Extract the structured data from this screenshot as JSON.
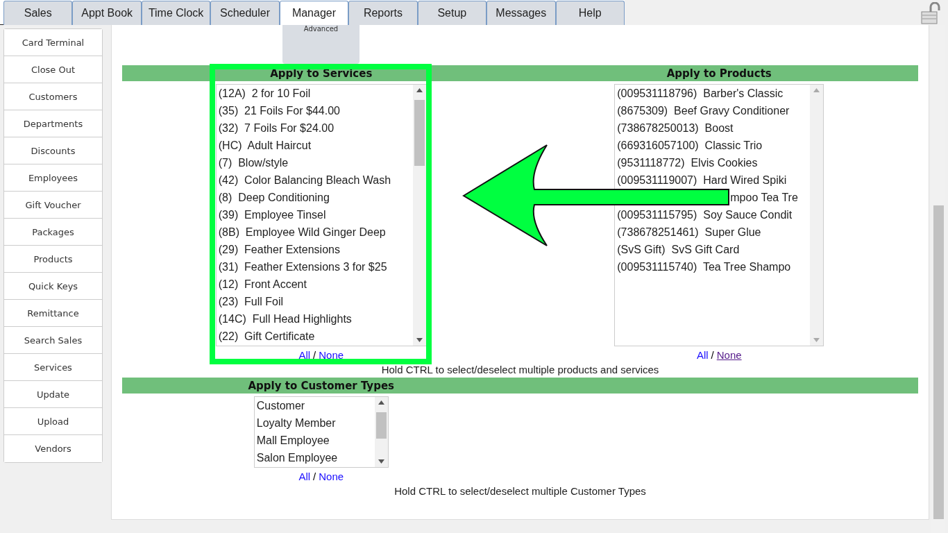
{
  "tabs": [
    {
      "label": "Sales",
      "selected": false
    },
    {
      "label": "Appt Book",
      "selected": false
    },
    {
      "label": "Time Clock",
      "selected": false
    },
    {
      "label": "Scheduler",
      "selected": false
    },
    {
      "label": "Manager",
      "selected": true
    },
    {
      "label": "Reports",
      "selected": false
    },
    {
      "label": "Setup",
      "selected": false
    },
    {
      "label": "Messages",
      "selected": false
    },
    {
      "label": "Help",
      "selected": false
    }
  ],
  "sidebar": {
    "items": [
      "Card Terminal",
      "Close Out",
      "Customers",
      "Departments",
      "Discounts",
      "Employees",
      "Gift Voucher",
      "Packages",
      "Products",
      "Quick Keys",
      "Remittance",
      "Search Sales",
      "Services",
      "Update",
      "Upload",
      "Vendors"
    ]
  },
  "subtab": {
    "label": "Advanced"
  },
  "apply_headers": [
    "Apply to Services",
    "Apply to Products"
  ],
  "services": {
    "items": [
      "(12A)  2 for 10 Foil",
      "(35)  21 Foils For $44.00",
      "(32)  7 Foils For $24.00",
      "(HC)  Adult Haircut",
      "(7)  Blow/style",
      "(42)  Color Balancing Bleach Wash",
      "(8)  Deep Conditioning",
      "(39)  Employee Tinsel",
      "(8B)  Employee Wild Ginger Deep",
      "(29)  Feather Extensions",
      "(31)  Feather Extensions 3 for $25",
      "(12)  Front Accent",
      "(23)  Full Foil",
      "(14C)  Full Head Highlights",
      "(22)  Gift Certificate"
    ],
    "all": "All",
    "sep": "/",
    "none": "None"
  },
  "products": {
    "items": [
      "(009531118796)  Barber's Classic",
      "(8675309)  Beef Gravy Conditioner",
      "(738678250013)  Boost",
      "(669316057100)  Classic Trio",
      "(9531118772)  Elvis Cookies",
      "(009531119007)  Hard Wired Spiki",
      "mpoo Tea Tre",
      "(009531115795)  Soy Sauce Condit",
      "(738678251461)  Super Glue",
      "(SvS Gift)  SvS Gift Card",
      "(009531115740)  Tea Tree Shampo"
    ],
    "all": "All",
    "sep": "/",
    "none": "None"
  },
  "products_hint": "Hold CTRL to select/deselect multiple products and services",
  "customer_types": {
    "header": "Apply to Customer Types",
    "items": [
      "Customer",
      "Loyalty Member",
      "Mall Employee",
      "Salon Employee"
    ],
    "all": "All",
    "sep": "/",
    "none": "None",
    "hint": "Hold CTRL to select/deselect multiple Customer Types"
  }
}
